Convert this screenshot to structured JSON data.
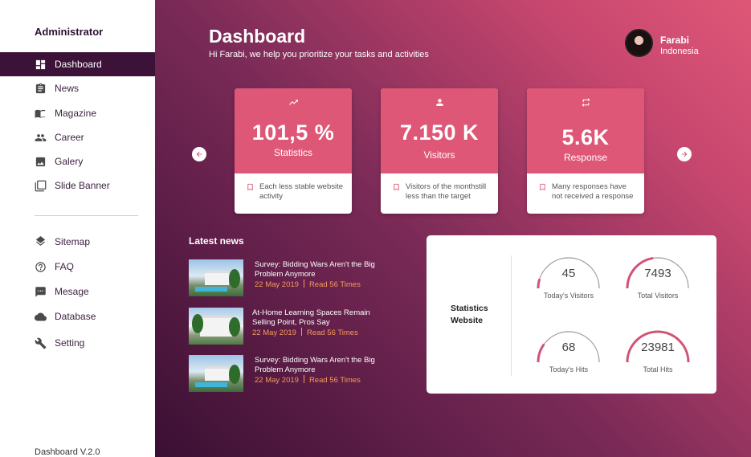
{
  "sidebar": {
    "brand": "Administrator",
    "items": [
      {
        "label": "Dashboard",
        "icon": "dashboard-icon",
        "active": true
      },
      {
        "label": "News",
        "icon": "clipboard-icon"
      },
      {
        "label": "Magazine",
        "icon": "book-icon"
      },
      {
        "label": "Career",
        "icon": "people-icon"
      },
      {
        "label": "Galery",
        "icon": "image-icon"
      },
      {
        "label": "Slide Banner",
        "icon": "slides-icon"
      },
      {
        "label": "Sitemap",
        "icon": "layers-icon"
      },
      {
        "label": "FAQ",
        "icon": "help-icon"
      },
      {
        "label": "Mesage",
        "icon": "message-icon"
      },
      {
        "label": "Database",
        "icon": "database-icon"
      },
      {
        "label": "Setting",
        "icon": "wrench-icon"
      }
    ],
    "version": "Dashboard V.2.0"
  },
  "header": {
    "title": "Dashboard",
    "subtitle": "Hi Farabi, we help you prioritize your tasks and activities"
  },
  "user": {
    "name": "Farabi",
    "country": "Indonesia"
  },
  "cards": [
    {
      "icon": "trending-up-icon",
      "value": "101,5 %",
      "label": "Statistics",
      "note": "Each less stable website activity"
    },
    {
      "icon": "person-icon",
      "value": "7.150 K",
      "label": "Visitors",
      "note": "Visitors of the monthstill less than the target"
    },
    {
      "icon": "repeat-icon",
      "value": "5.6K",
      "label": "Response",
      "note": "Many responses have not received a response"
    }
  ],
  "news": {
    "heading": "Latest news",
    "items": [
      {
        "title": "Survey: Bidding Wars Aren't the Big Problem Anymore",
        "date": "22 May 2019",
        "reads": "Read 56 Times"
      },
      {
        "title": "At-Home Learning Spaces Remain Selling Point, Pros Say",
        "date": "22 May 2019",
        "reads": "Read 56 Times"
      },
      {
        "title": "Survey: Bidding Wars Aren't the Big Problem Anymore",
        "date": "22 May 2019",
        "reads": "Read 56 Times"
      }
    ]
  },
  "stats": {
    "title": "Statistics Website",
    "gauges": [
      {
        "value": "45",
        "label": "Today's Visitors",
        "fraction": 0.1
      },
      {
        "value": "7493",
        "label": "Total Visitors",
        "fraction": 0.45
      },
      {
        "value": "68",
        "label": "Today's Hits",
        "fraction": 0.2
      },
      {
        "value": "23981",
        "label": "Total Hits",
        "fraction": 1.0
      }
    ]
  },
  "colors": {
    "accent": "#de5777",
    "sidebar_active": "#3d1238",
    "meta": "#f59b5c"
  }
}
